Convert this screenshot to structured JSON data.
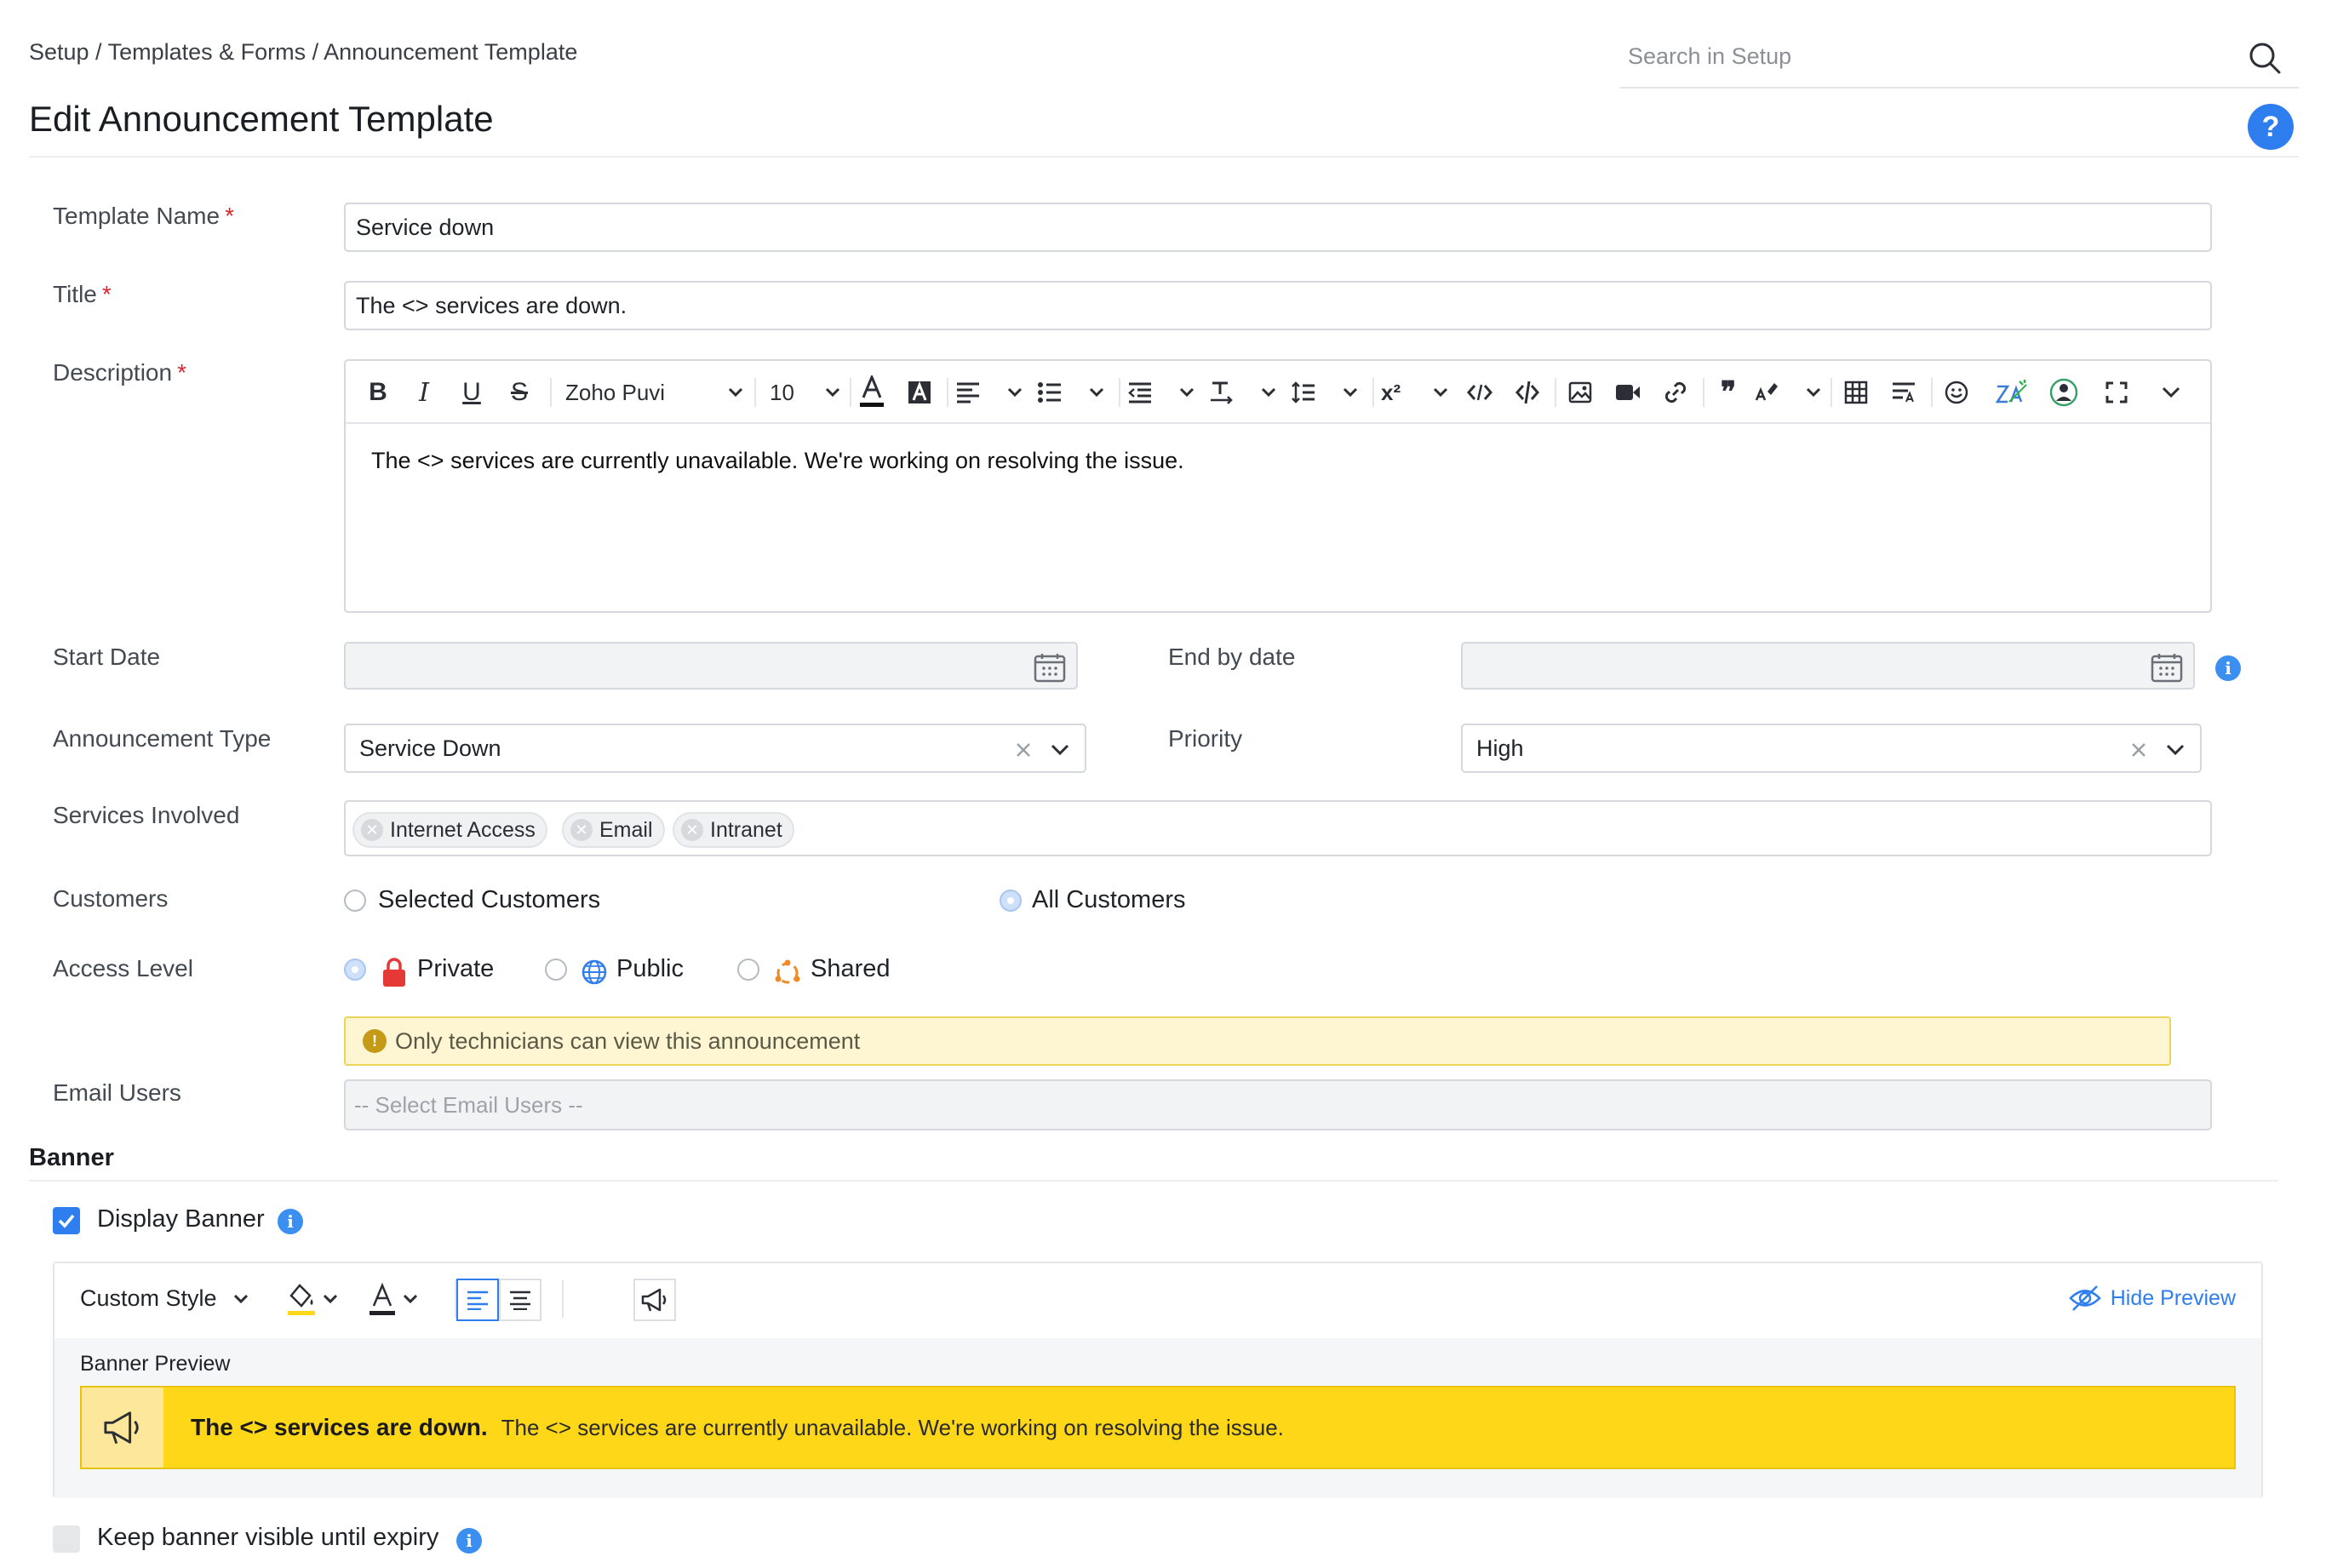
{
  "breadcrumb": "Setup / Templates & Forms / Announcement Template",
  "search": {
    "placeholder": "Search in Setup"
  },
  "page_title": "Edit Announcement Template",
  "help_label": "?",
  "form": {
    "template_name": {
      "label": "Template Name",
      "value": "Service down"
    },
    "title": {
      "label": "Title",
      "value": "The <> services are down."
    },
    "description": {
      "label": "Description",
      "font": "Zoho Puvi",
      "size": "10",
      "body": "The <> services are currently unavailable. We're working on resolving the issue."
    },
    "start_date": {
      "label": "Start Date",
      "value": ""
    },
    "end_date": {
      "label": "End by date",
      "value": ""
    },
    "announcement_type": {
      "label": "Announcement Type",
      "value": "Service Down"
    },
    "priority": {
      "label": "Priority",
      "value": "High"
    },
    "services": {
      "label": "Services Involved",
      "items": [
        "Internet Access",
        "Email",
        "Intranet"
      ]
    },
    "customers": {
      "label": "Customers",
      "options": [
        "Selected Customers",
        "All Customers"
      ],
      "selected": "All Customers"
    },
    "access_level": {
      "label": "Access Level",
      "options": [
        "Private",
        "Public",
        "Shared"
      ],
      "selected": "Private"
    },
    "notice": "Only technicians can view this announcement",
    "email_users": {
      "label": "Email Users",
      "placeholder": "-- Select Email Users --"
    }
  },
  "banner": {
    "heading": "Banner",
    "display_banner": {
      "label": "Display Banner",
      "checked": true
    },
    "style_label": "Custom Style",
    "hide_preview": "Hide Preview",
    "preview_label": "Banner Preview",
    "preview_title": "The <> services are down.",
    "preview_body": "The <> services are currently unavailable. We're working on resolving the issue.",
    "keep_visible": {
      "label": "Keep banner visible until expiry",
      "checked": false
    }
  },
  "colors": {
    "accent": "#2f7ef0",
    "required": "#d9262c",
    "banner_bg": "#fed718",
    "notice_bg": "#fef5d3"
  }
}
